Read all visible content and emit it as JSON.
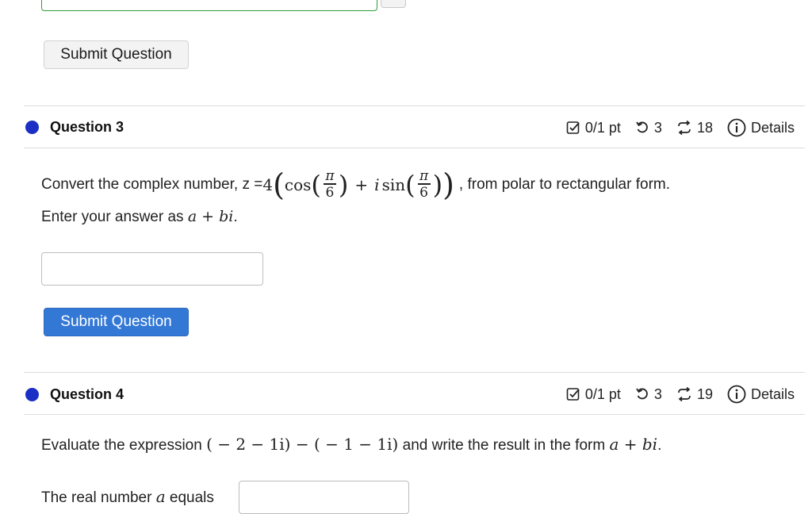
{
  "prev_question": {
    "submit_label": "Submit Question"
  },
  "question3": {
    "title": "Question 3",
    "score": "0/1 pt",
    "retries": "3",
    "attempts": "18",
    "details_label": "Details",
    "prompt_before": "Convert the complex number, z = ",
    "prompt_after": ", from polar to rectangular form.",
    "math": {
      "coef": "4",
      "cos": "cos",
      "sin": "sin",
      "i": "i",
      "plus": "+",
      "frac_num": "π",
      "frac_den": "6"
    },
    "instruction_before": "Enter your answer as ",
    "instruction_math": "a + bi",
    "instruction_after": ".",
    "submit_label": "Submit Question"
  },
  "question4": {
    "title": "Question 4",
    "score": "0/1 pt",
    "retries": "3",
    "attempts": "19",
    "details_label": "Details",
    "prompt_before": "Evaluate the expression ",
    "prompt_math": "( − 2 − 1i) − ( − 1 − 1i)",
    "prompt_middle": " and write the result in the form ",
    "prompt_form": "a + bi",
    "prompt_after": ".",
    "real_label_before": "The real number ",
    "real_label_var": "a",
    "real_label_after": " equals"
  },
  "colors": {
    "accent_blue": "#3478d6",
    "dot_blue": "#1c2fc4",
    "correct_green": "#2e9e3e"
  }
}
